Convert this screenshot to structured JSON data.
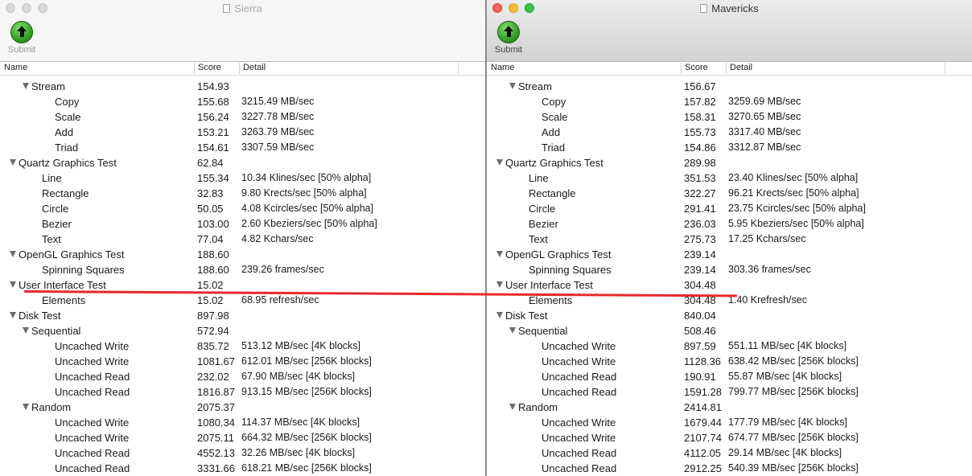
{
  "colors": {
    "red_annotation": "#e8292b",
    "submit_green": "#2f9a1f"
  },
  "columns": {
    "name": "Name",
    "score": "Score",
    "detail": "Detail"
  },
  "submit_label": "Submit",
  "windows": [
    {
      "title": "Sierra",
      "rows": [
        {
          "name": "Stream",
          "score": "154.93",
          "detail": "",
          "expanded": true,
          "level": 2
        },
        {
          "name": "Copy",
          "score": "155.68",
          "detail": "3215.49 MB/sec",
          "level": 3
        },
        {
          "name": "Scale",
          "score": "156.24",
          "detail": "3227.78 MB/sec",
          "level": 3
        },
        {
          "name": "Add",
          "score": "153.21",
          "detail": "3263.79 MB/sec",
          "level": 3
        },
        {
          "name": "Triad",
          "score": "154.61",
          "detail": "3307.59 MB/sec",
          "level": 3
        },
        {
          "name": "Quartz Graphics Test",
          "score": "62.84",
          "detail": "",
          "expanded": true,
          "level": 1
        },
        {
          "name": "Line",
          "score": "155.34",
          "detail": "10.34 Klines/sec [50% alpha]",
          "level": 2
        },
        {
          "name": "Rectangle",
          "score": "32.83",
          "detail": "9.80 Krects/sec [50% alpha]",
          "level": 2
        },
        {
          "name": "Circle",
          "score": "50.05",
          "detail": "4.08 Kcircles/sec [50% alpha]",
          "level": 2
        },
        {
          "name": "Bezier",
          "score": "103.00",
          "detail": "2.60 Kbeziers/sec [50% alpha]",
          "level": 2
        },
        {
          "name": "Text",
          "score": "77.04",
          "detail": "4.82 Kchars/sec",
          "level": 2
        },
        {
          "name": "OpenGL Graphics Test",
          "score": "188.60",
          "detail": "",
          "expanded": true,
          "level": 1
        },
        {
          "name": "Spinning Squares",
          "score": "188.60",
          "detail": "239.26 frames/sec",
          "level": 2
        },
        {
          "name": "User Interface Test",
          "score": "15.02",
          "detail": "",
          "expanded": true,
          "level": 1
        },
        {
          "name": "Elements",
          "score": "15.02",
          "detail": "68.95 refresh/sec",
          "level": 2
        },
        {
          "name": "Disk Test",
          "score": "897.98",
          "detail": "",
          "expanded": true,
          "level": 1
        },
        {
          "name": "Sequential",
          "score": "572.94",
          "detail": "",
          "expanded": true,
          "level": 2
        },
        {
          "name": "Uncached Write",
          "score": "835.72",
          "detail": "513.12 MB/sec [4K blocks]",
          "level": 3
        },
        {
          "name": "Uncached Write",
          "score": "1081.67",
          "detail": "612.01 MB/sec [256K blocks]",
          "level": 3
        },
        {
          "name": "Uncached Read",
          "score": "232.02",
          "detail": "67.90 MB/sec [4K blocks]",
          "level": 3
        },
        {
          "name": "Uncached Read",
          "score": "1816.87",
          "detail": "913.15 MB/sec [256K blocks]",
          "level": 3
        },
        {
          "name": "Random",
          "score": "2075.37",
          "detail": "",
          "expanded": true,
          "level": 2
        },
        {
          "name": "Uncached Write",
          "score": "1080.34",
          "detail": "114.37 MB/sec [4K blocks]",
          "level": 3
        },
        {
          "name": "Uncached Write",
          "score": "2075.11",
          "detail": "664.32 MB/sec [256K blocks]",
          "level": 3
        },
        {
          "name": "Uncached Read",
          "score": "4552.13",
          "detail": "32.26 MB/sec [4K blocks]",
          "level": 3
        },
        {
          "name": "Uncached Read",
          "score": "3331.66",
          "detail": "618.21 MB/sec [256K blocks]",
          "level": 3
        }
      ]
    },
    {
      "title": "Mavericks",
      "rows": [
        {
          "name": "Stream",
          "score": "156.67",
          "detail": "",
          "expanded": true,
          "level": 2
        },
        {
          "name": "Copy",
          "score": "157.82",
          "detail": "3259.69 MB/sec",
          "level": 3
        },
        {
          "name": "Scale",
          "score": "158.31",
          "detail": "3270.65 MB/sec",
          "level": 3
        },
        {
          "name": "Add",
          "score": "155.73",
          "detail": "3317.40 MB/sec",
          "level": 3
        },
        {
          "name": "Triad",
          "score": "154.86",
          "detail": "3312.87 MB/sec",
          "level": 3
        },
        {
          "name": "Quartz Graphics Test",
          "score": "289.98",
          "detail": "",
          "expanded": true,
          "level": 1
        },
        {
          "name": "Line",
          "score": "351.53",
          "detail": "23.40 Klines/sec [50% alpha]",
          "level": 2
        },
        {
          "name": "Rectangle",
          "score": "322.27",
          "detail": "96.21 Krects/sec [50% alpha]",
          "level": 2
        },
        {
          "name": "Circle",
          "score": "291.41",
          "detail": "23.75 Kcircles/sec [50% alpha]",
          "level": 2
        },
        {
          "name": "Bezier",
          "score": "236.03",
          "detail": "5.95 Kbeziers/sec [50% alpha]",
          "level": 2
        },
        {
          "name": "Text",
          "score": "275.73",
          "detail": "17.25 Kchars/sec",
          "level": 2
        },
        {
          "name": "OpenGL Graphics Test",
          "score": "239.14",
          "detail": "",
          "expanded": true,
          "level": 1
        },
        {
          "name": "Spinning Squares",
          "score": "239.14",
          "detail": "303.36 frames/sec",
          "level": 2
        },
        {
          "name": "User Interface Test",
          "score": "304.48",
          "detail": "",
          "expanded": true,
          "level": 1
        },
        {
          "name": "Elements",
          "score": "304.48",
          "detail": "1.40 Krefresh/sec",
          "level": 2
        },
        {
          "name": "Disk Test",
          "score": "840.04",
          "detail": "",
          "expanded": true,
          "level": 1
        },
        {
          "name": "Sequential",
          "score": "508.46",
          "detail": "",
          "expanded": true,
          "level": 2
        },
        {
          "name": "Uncached Write",
          "score": "897.59",
          "detail": "551.11 MB/sec [4K blocks]",
          "level": 3
        },
        {
          "name": "Uncached Write",
          "score": "1128.36",
          "detail": "638.42 MB/sec [256K blocks]",
          "level": 3
        },
        {
          "name": "Uncached Read",
          "score": "190.91",
          "detail": "55.87 MB/sec [4K blocks]",
          "level": 3
        },
        {
          "name": "Uncached Read",
          "score": "1591.28",
          "detail": "799.77 MB/sec [256K blocks]",
          "level": 3
        },
        {
          "name": "Random",
          "score": "2414.81",
          "detail": "",
          "expanded": true,
          "level": 2
        },
        {
          "name": "Uncached Write",
          "score": "1679.44",
          "detail": "177.79 MB/sec [4K blocks]",
          "level": 3
        },
        {
          "name": "Uncached Write",
          "score": "2107.74",
          "detail": "674.77 MB/sec [256K blocks]",
          "level": 3
        },
        {
          "name": "Uncached Read",
          "score": "4112.05",
          "detail": "29.14 MB/sec [4K blocks]",
          "level": 3
        },
        {
          "name": "Uncached Read",
          "score": "2912.25",
          "detail": "540.39 MB/sec [256K blocks]",
          "level": 3
        }
      ]
    }
  ]
}
